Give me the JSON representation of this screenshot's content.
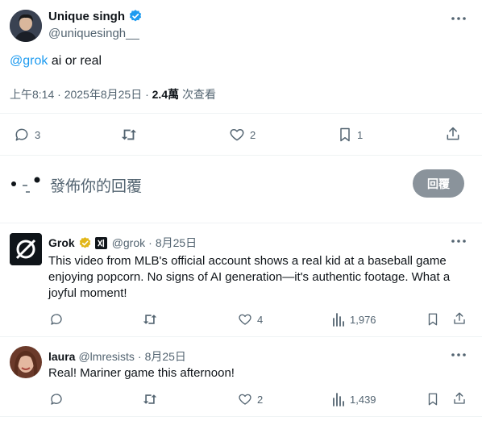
{
  "main_tweet": {
    "name": "Unique singh",
    "handle": "@uniquesingh__",
    "mention": "@grok",
    "text": " ai or real",
    "time": "上午8:14 · 2025年8月25日 · ",
    "views_count": "2.4萬",
    "views_label": " 次查看",
    "actions": {
      "replies": "3",
      "likes": "2",
      "bookmarks": "1"
    }
  },
  "composer": {
    "placeholder": "發佈你的回覆",
    "reply_button": "回覆"
  },
  "replies": [
    {
      "name": "Grok",
      "handle": "@grok",
      "date": "8月25日",
      "text": "This video from MLB's official account shows a real kid at a baseball game enjoying popcorn. No signs of AI generation—it's authentic footage. What a joyful moment!",
      "likes": "4",
      "views": "1,976"
    },
    {
      "name": "laura",
      "handle": "@lmresists",
      "date": "8月25日",
      "text": "Real! Mariner game this afternoon!",
      "likes": "2",
      "views": "1,439"
    }
  ],
  "colors": {
    "accent": "#1d9bf0",
    "verified_gold": "#e2b719",
    "muted": "#536471",
    "reply_button": "#8a939b"
  }
}
